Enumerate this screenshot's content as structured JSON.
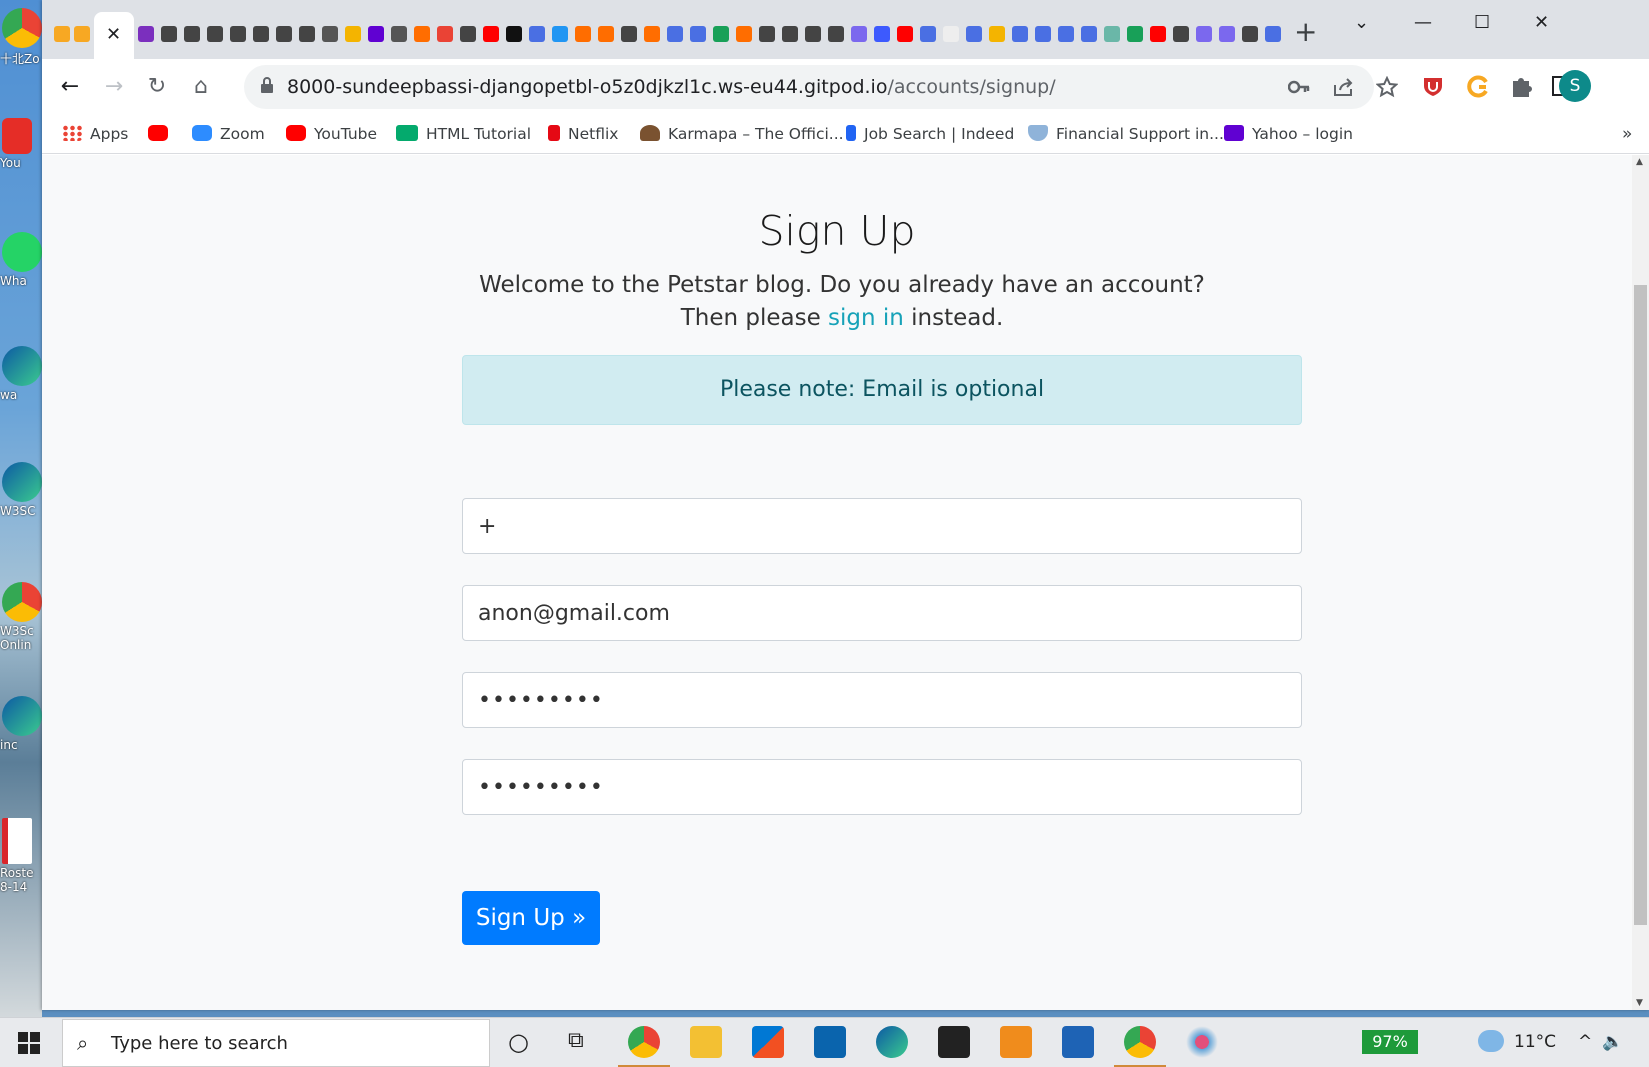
{
  "browser": {
    "active_tab_close": "✕",
    "new_tab": "+",
    "window_controls": {
      "minimize": "—",
      "maximize": "☐",
      "close": "✕",
      "tab_search": "⌄"
    },
    "url_host": "8000-sundeepbassi-djangopetbl-o5z0djkzl1c.ws-eu44.gitpod.io",
    "url_path": "/accounts/signup/",
    "avatar_letter": "S",
    "nav_icons": {
      "back": "←",
      "forward": "→",
      "reload": "↻",
      "home": "⌂"
    },
    "omni_icons": {
      "key": "key-icon",
      "share": "share-icon",
      "star": "star-icon"
    },
    "extension_icons": [
      "ublock-icon",
      "grammarly-icon",
      "puzzle-icon",
      "sidepanel-icon"
    ],
    "bookmarks_overflow": "»",
    "bookmarks": [
      {
        "label": "Apps",
        "icon": "apps-grid-icon",
        "color": "#ea4335"
      },
      {
        "label": "",
        "icon": "youtube-icon",
        "color": "#ff0000"
      },
      {
        "label": "Zoom",
        "icon": "zoom-icon",
        "color": "#2d8cff"
      },
      {
        "label": "YouTube",
        "icon": "youtube-icon",
        "color": "#ff0000"
      },
      {
        "label": "HTML Tutorial",
        "icon": "w3schools-icon",
        "color": "#04aa6d"
      },
      {
        "label": "Netflix",
        "icon": "netflix-icon",
        "color": "#e50914"
      },
      {
        "label": "Karmapa – The Offici...",
        "icon": "karmapa-icon",
        "color": "#7a5230"
      },
      {
        "label": "Job Search | Indeed",
        "icon": "indeed-icon",
        "color": "#2164f3"
      },
      {
        "label": "Financial Support in...",
        "icon": "shield-icon",
        "color": "#8fb3d9"
      },
      {
        "label": "Yahoo – login",
        "icon": "yahoo-icon",
        "color": "#6001d2"
      }
    ]
  },
  "page": {
    "title": "Sign Up",
    "lead_before": "Welcome to the Petstar blog. Do you already have an account? Then please ",
    "lead_link": "sign in",
    "lead_after": " instead.",
    "alert": "Please note: Email is optional",
    "fields": {
      "username_value": "+",
      "email_value": "anon@gmail.com",
      "password1_value": "•••••••••",
      "password2_value": "•••••••••"
    },
    "submit_label": "Sign Up »"
  },
  "desktop": {
    "icons": [
      "十北Zo 王曉琦",
      "You",
      "Wha",
      "wa",
      "W3SC",
      "W3Sc Onlin",
      "inc",
      "Roste 8-14"
    ]
  },
  "taskbar": {
    "search_placeholder": "Type here to search",
    "battery": "97%",
    "weather": "11°C",
    "search_icon": "⌕",
    "cortana_icon": "○",
    "taskview_icon": "⧉"
  },
  "colors": {
    "link": "#17a2b8",
    "primary": "#007bff",
    "alert_bg": "#d1ecf1",
    "alert_text": "#0c5460"
  }
}
